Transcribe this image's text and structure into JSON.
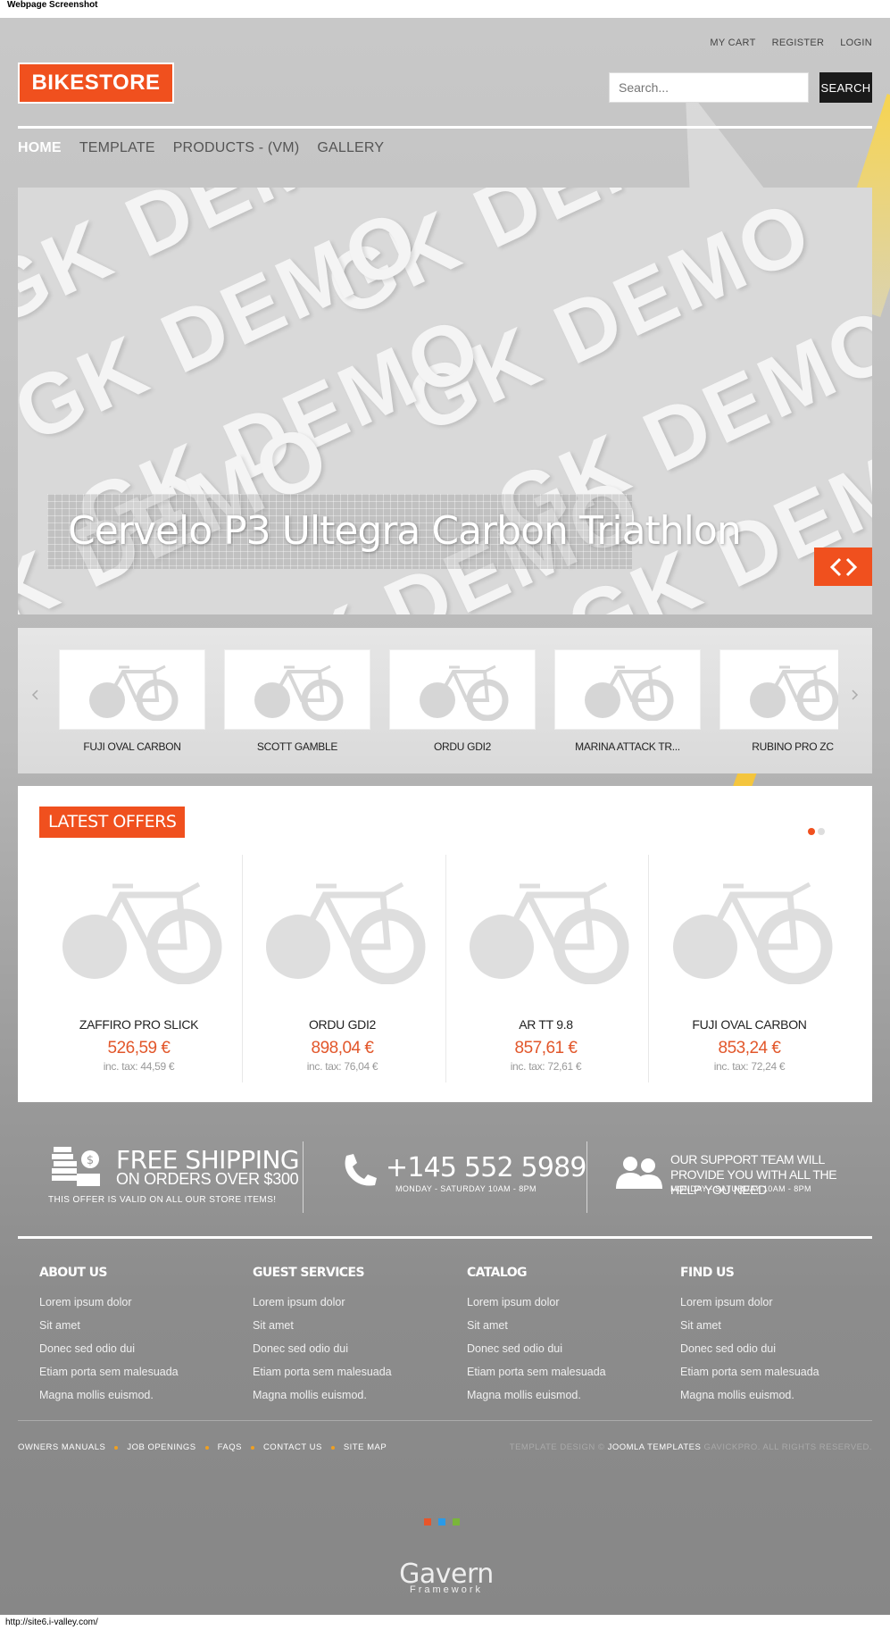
{
  "capture": {
    "title": "Webpage Screenshot",
    "url": "http://site6.i-valley.com/"
  },
  "header": {
    "top_links": [
      "MY CART",
      "REGISTER",
      "LOGIN"
    ],
    "logo": "BIKESTORE",
    "search_placeholder": "Search...",
    "search_button": "SEARCH",
    "nav": [
      "HOME",
      "TEMPLATE",
      "PRODUCTS - (VM)",
      "GALLERY"
    ]
  },
  "slider": {
    "watermark": "GK DEMO",
    "caption": "Cervelo P3 Ultegra Carbon Triathlon",
    "nav_icon": "code-arrows-icon"
  },
  "thumbs": {
    "items": [
      "FUJI OVAL CARBON",
      "SCOTT GAMBLE",
      "ORDU GDI2",
      "MARINA ATTACK TR...",
      "RUBINO PRO ZC"
    ]
  },
  "offers": {
    "title": "LATEST OFFERS",
    "products": [
      {
        "name": "ZAFFIRO PRO SLICK",
        "price": "526,59 €",
        "tax": "inc. tax: 44,59 €"
      },
      {
        "name": "ORDU GDI2",
        "price": "898,04 €",
        "tax": "inc. tax: 76,04 €"
      },
      {
        "name": "AR TT 9.8",
        "price": "857,61 €",
        "tax": "inc. tax: 72,61 €"
      },
      {
        "name": "FUJI OVAL CARBON",
        "price": "853,24 €",
        "tax": "inc. tax: 72,24 €"
      }
    ]
  },
  "info": {
    "shipping_big": "FREE SHIPPING",
    "shipping_sub": "ON ORDERS  OVER $300",
    "shipping_note": "THIS OFFER IS VALID ON ALL OUR STORE ITEMS!",
    "phone": "+145 552 5989",
    "phone_note": "MONDAY - SATURDAY 10AM - 8PM",
    "support": "OUR SUPPORT TEAM WILL PROVIDE YOU WITH ALL THE HELP YOU NEED",
    "support_note": "MONDAY - SATURDAY 10AM - 8PM"
  },
  "footer": {
    "columns": [
      {
        "title": "ABOUT US",
        "items": [
          "Lorem ipsum dolor",
          "Sit amet",
          "Donec sed odio dui",
          "Etiam porta sem malesuada",
          "Magna mollis euismod."
        ]
      },
      {
        "title": "GUEST SERVICES",
        "items": [
          "Lorem ipsum dolor",
          "Sit amet",
          "Donec sed odio dui",
          "Etiam porta sem malesuada",
          "Magna mollis euismod."
        ]
      },
      {
        "title": "CATALOG",
        "items": [
          "Lorem ipsum dolor",
          "Sit amet",
          "Donec sed odio dui",
          "Etiam porta sem malesuada",
          "Magna mollis euismod."
        ]
      },
      {
        "title": "FIND US",
        "items": [
          "Lorem ipsum dolor",
          "Sit amet",
          "Donec sed odio dui",
          "Etiam porta sem malesuada",
          "Magna mollis euismod."
        ]
      }
    ],
    "bottom_links": [
      "OWNERS MANUALS",
      "JOB OPENINGS",
      "FAQS",
      "CONTACT US",
      "SITE MAP"
    ],
    "copyright_pre": "TEMPLATE DESIGN ©",
    "copyright_link": "JOOMLA TEMPLATES",
    "copyright_post": "GAVICKPRO. ALL RIGHTS RESERVED.",
    "framework_logo": "Gavern",
    "framework_sub": "Framework"
  },
  "colors": {
    "accent": "#f0501e",
    "style_swatches": [
      "#e8552a",
      "#2a9ae8",
      "#7ab63a"
    ]
  }
}
